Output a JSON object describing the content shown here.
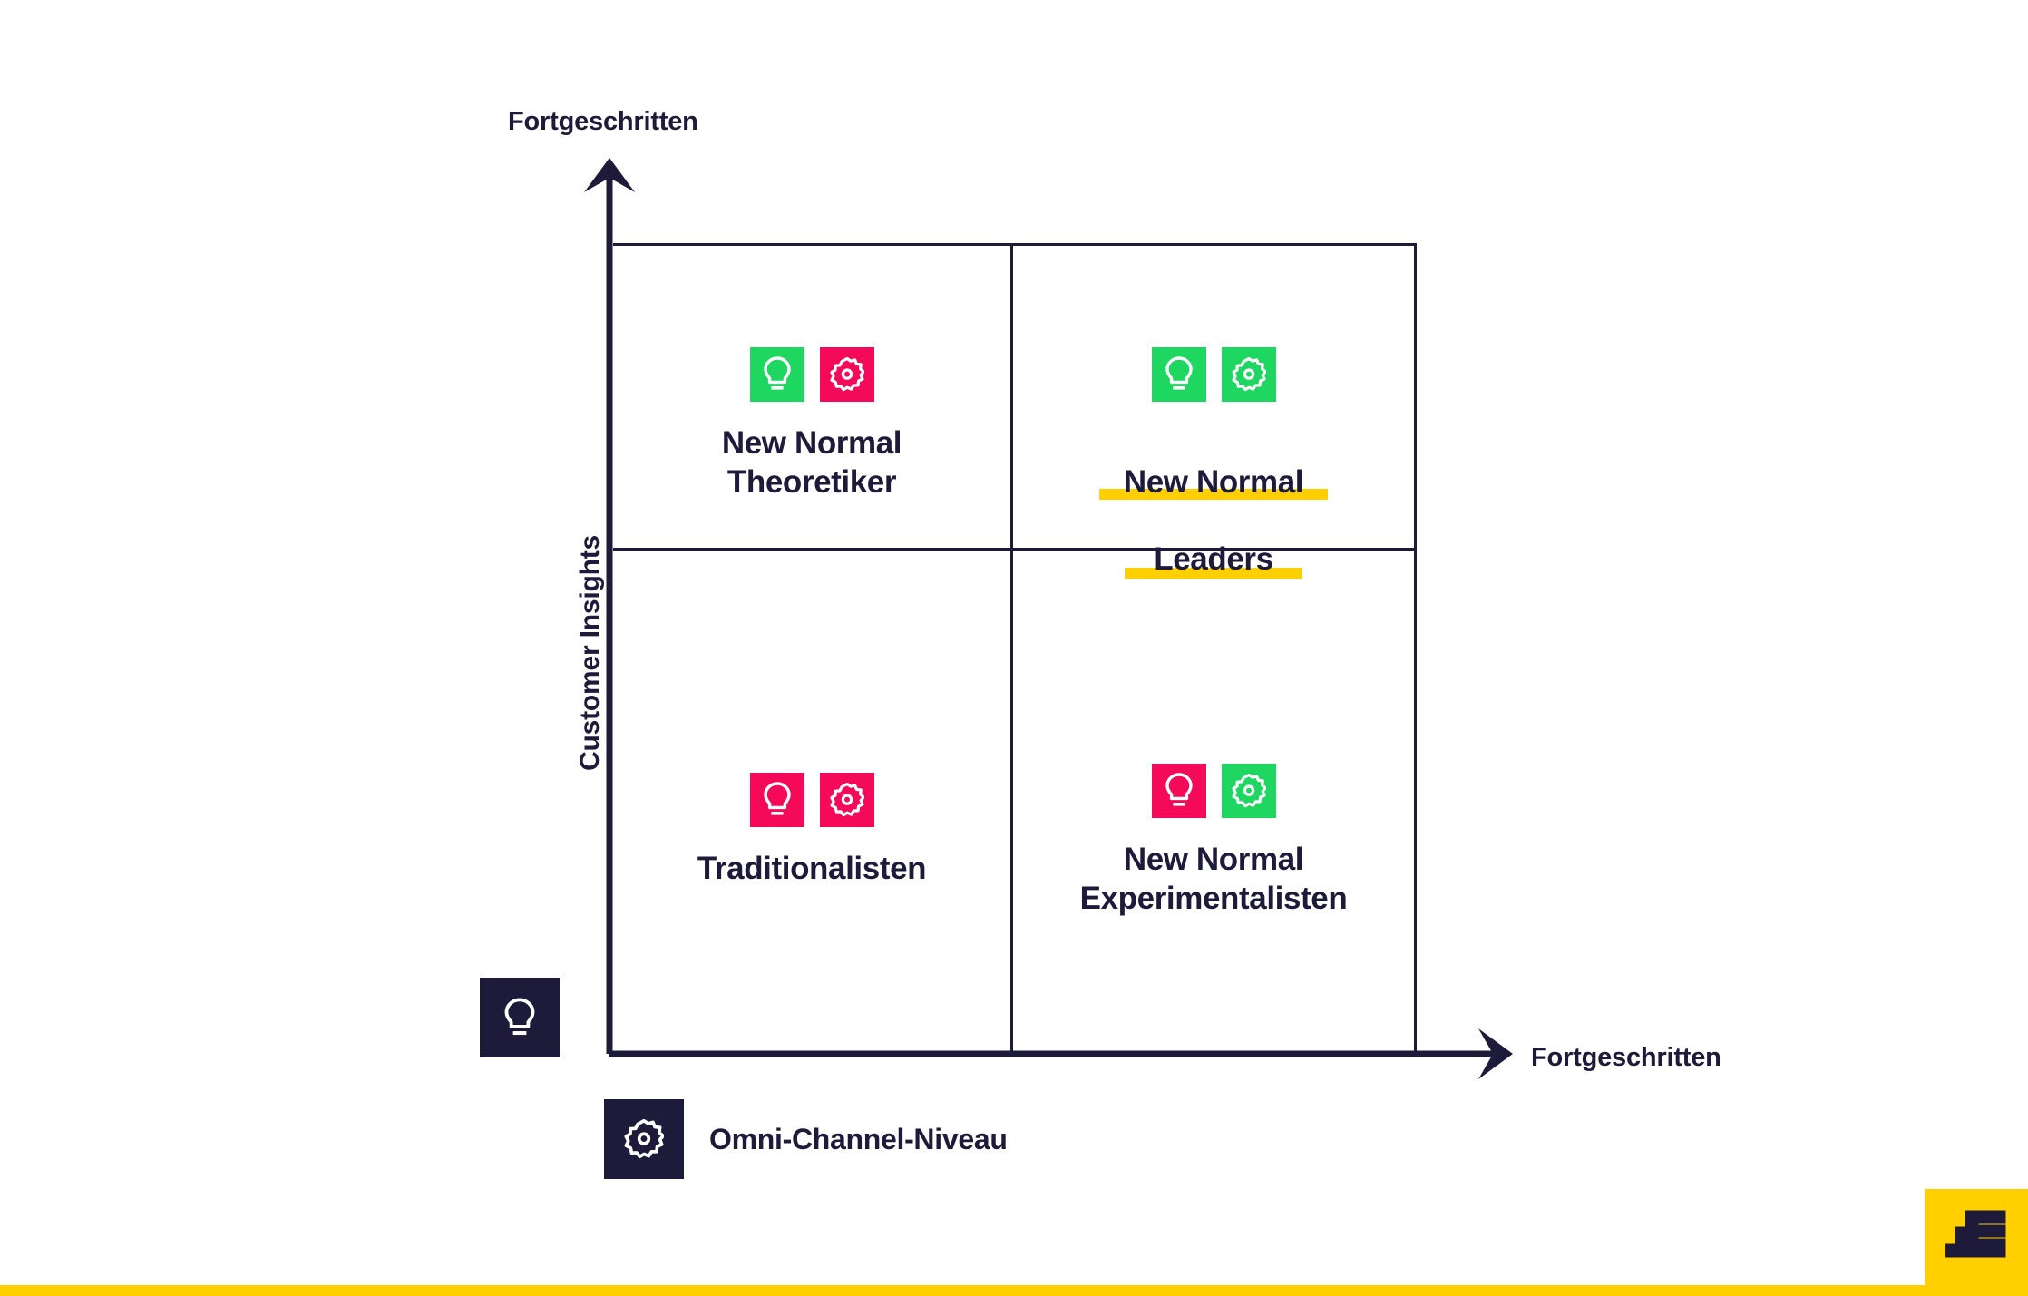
{
  "chart_data": {
    "type": "scatter",
    "title": "",
    "xlabel": "Omni-Channel-Niveau",
    "ylabel": "Customer Insights",
    "x_axis_end_label": "Fortgeschritten",
    "y_axis_end_label": "Fortgeschritten",
    "grid": true,
    "legend_position": "bottom-left",
    "quadrants": [
      {
        "id": "top-left",
        "label": "New Normal\nTheoretiker",
        "customer_insights": "Fortgeschritten",
        "omni_channel": "Niedrig",
        "icons": [
          {
            "name": "lightbulb-icon",
            "color": "#1ED760",
            "meaning": "Customer Insights"
          },
          {
            "name": "gear-icon",
            "color": "#F50A5A",
            "meaning": "Omni-Channel-Niveau"
          }
        ],
        "highlighted": false
      },
      {
        "id": "top-right",
        "label": "New Normal\nLeaders",
        "customer_insights": "Fortgeschritten",
        "omni_channel": "Fortgeschritten",
        "icons": [
          {
            "name": "lightbulb-icon",
            "color": "#1ED760",
            "meaning": "Customer Insights"
          },
          {
            "name": "gear-icon",
            "color": "#1ED760",
            "meaning": "Omni-Channel-Niveau"
          }
        ],
        "highlighted": true,
        "highlight_color": "#FFCF00"
      },
      {
        "id": "bottom-left",
        "label": "Traditionalisten",
        "customer_insights": "Niedrig",
        "omni_channel": "Niedrig",
        "icons": [
          {
            "name": "lightbulb-icon",
            "color": "#F50A5A",
            "meaning": "Customer Insights"
          },
          {
            "name": "gear-icon",
            "color": "#F50A5A",
            "meaning": "Omni-Channel-Niveau"
          }
        ],
        "highlighted": false
      },
      {
        "id": "bottom-right",
        "label": "New Normal\nExperimentalisten",
        "customer_insights": "Niedrig",
        "omni_channel": "Fortgeschritten",
        "icons": [
          {
            "name": "lightbulb-icon",
            "color": "#F50A5A",
            "meaning": "Customer Insights"
          },
          {
            "name": "gear-icon",
            "color": "#1ED760",
            "meaning": "Omni-Channel-Niveau"
          }
        ],
        "highlighted": false
      }
    ],
    "legend": [
      {
        "icon": "lightbulb-icon",
        "label": "",
        "swatch": "#1E1B3A"
      },
      {
        "icon": "gear-icon",
        "label": "Omni-Channel-Niveau",
        "swatch": "#1E1B3A"
      }
    ]
  },
  "axes": {
    "y_top_label": "Fortgeschritten",
    "y_title": "Customer Insights",
    "x_end_label": "Fortgeschritten"
  },
  "quadrants": {
    "top_left": {
      "line1": "New Normal",
      "line2": "Theoretiker"
    },
    "top_right": {
      "line1": "New Normal",
      "line2": "Leaders"
    },
    "bottom_left": {
      "line1": "Traditionalisten",
      "line2": ""
    },
    "bottom_right": {
      "line1": "New Normal",
      "line2": "Experimentalisten"
    }
  },
  "legend": {
    "customer_insights_label": "",
    "omni_channel_label": "Omni-Channel-Niveau"
  },
  "colors": {
    "navy": "#1E1B3A",
    "green": "#1ED760",
    "pink": "#F50A5A",
    "yellow": "#FFCF00",
    "white": "#FFFFFF"
  },
  "brand": {
    "logo_glyph": "E"
  }
}
